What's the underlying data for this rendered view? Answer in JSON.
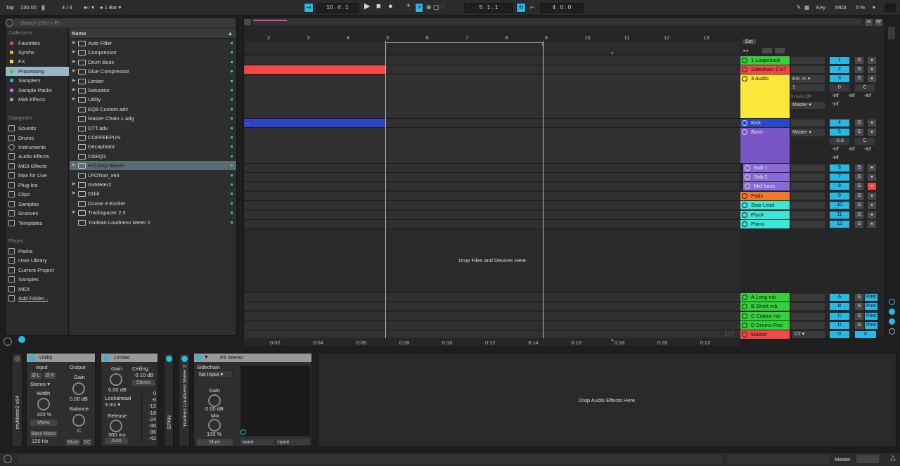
{
  "transport": {
    "tap": "Tap",
    "tempo": "130.00",
    "signature": "4 / 4",
    "quantize": "1 Bar",
    "position": "10 . 4 . 1",
    "loop_start": "5 . 1 . 1",
    "loop_length": "4 . 0 . 0",
    "key_label": "Key",
    "midi_label": "MIDI",
    "cpu": "5 %"
  },
  "browser": {
    "search_placeholder": "Search (Ctrl + F)",
    "collections_label": "Collections",
    "collections": [
      {
        "label": "Favorites",
        "color": "#e8442f"
      },
      {
        "label": "Synths",
        "color": "#f0a33c"
      },
      {
        "label": "FX",
        "color": "#f2e33c"
      },
      {
        "label": "Processing",
        "color": "#39c74a"
      },
      {
        "label": "Samplers",
        "color": "#3aa6e8"
      },
      {
        "label": "Sample Packs",
        "color": "#b36fe0"
      },
      {
        "label": "Midi Effects",
        "color": "#9a9a9a"
      }
    ],
    "categories_label": "Categories",
    "categories": [
      "Sounds",
      "Drums",
      "Instruments",
      "Audio Effects",
      "MIDI Effects",
      "Max for Live",
      "Plug-Ins",
      "Clips",
      "Samples",
      "Grooves",
      "Templates"
    ],
    "places_label": "Places",
    "places": [
      "Packs",
      "User Library",
      "Current Project",
      "Samples",
      "MIDI",
      "Add Folder..."
    ],
    "name_header": "Name",
    "items": [
      {
        "label": "Auto Filter",
        "folder": true
      },
      {
        "label": "Compressor",
        "folder": true
      },
      {
        "label": "Drum Buss",
        "folder": true
      },
      {
        "label": "Glue Compressor",
        "folder": true
      },
      {
        "label": "Limiter",
        "folder": true
      },
      {
        "label": "Saturator",
        "folder": true
      },
      {
        "label": "Utility",
        "folder": true
      },
      {
        "label": "EQ8 Custom.adv",
        "folder": false
      },
      {
        "label": "Master Chain 1.adg",
        "folder": false
      },
      {
        "label": "OTT.adv",
        "folder": false
      },
      {
        "label": "COFFEEPUN",
        "folder": false
      },
      {
        "label": "Decapitator",
        "folder": false
      },
      {
        "label": "DSEQ3",
        "folder": false
      },
      {
        "label": "H-Comp Stereo",
        "folder": true
      },
      {
        "label": "LFOTool_x64",
        "folder": false
      },
      {
        "label": "mvMeter2",
        "folder": true
      },
      {
        "label": "Orbit",
        "folder": true
      },
      {
        "label": "Ozone 9 Exciter",
        "folder": false
      },
      {
        "label": "Trackspacer 2.5",
        "folder": true
      },
      {
        "label": "Youlean Loudness Meter 2",
        "folder": false
      }
    ]
  },
  "arrangement": {
    "bars": [
      "2",
      "3",
      "4",
      "5",
      "6",
      "7",
      "8",
      "9",
      "10",
      "11",
      "12",
      "13"
    ],
    "times": [
      "0:02",
      "0:04",
      "0:06",
      "0:08",
      "0:10",
      "0:12",
      "0:14",
      "0:16",
      "0:18",
      "0:20",
      "0:22"
    ],
    "drop_files": "Drop Files and Devices Here",
    "set_label": "Set",
    "page_indicator": "1/4",
    "clip_label": "..."
  },
  "tracks": [
    {
      "name": "1 Loopcloud",
      "color": "#35d13a",
      "num": "1"
    },
    {
      "name": "Sidechain CNT",
      "color": "#f44848",
      "num": "2"
    },
    {
      "name": "3 Audio",
      "color": "#f9e83a",
      "num": "3",
      "input": "Ext. In",
      "channel": "1",
      "out": "Master",
      "vol": "0",
      "pan": "C",
      "inf1": "-inf",
      "inf2": "-inf",
      "inf3": "-inf",
      "inf4": "-inf"
    },
    {
      "name": "Kick",
      "color": "#2b46c8",
      "num": "4"
    },
    {
      "name": "Bass",
      "color": "#7a55c8",
      "num": "5",
      "out": "Master",
      "vol": "-5.8",
      "pan": "C",
      "inf1": "-inf",
      "inf2": "-inf",
      "inf3": "-inf",
      "inf4": "-inf"
    },
    {
      "name": "Sub 1",
      "color": "#8a6ad8",
      "num": "6"
    },
    {
      "name": "Sub 2",
      "color": "#8a6ad8",
      "num": "7"
    },
    {
      "name": "Mid bass",
      "color": "#8a6ad8",
      "num": "8"
    },
    {
      "name": "Pads",
      "color": "#f07a28",
      "num": "9"
    },
    {
      "name": "Saw Lead",
      "color": "#3ae8d8",
      "num": "10"
    },
    {
      "name": "Pluck",
      "color": "#3ae8d8",
      "num": "11"
    },
    {
      "name": "Piano",
      "color": "#3ae8d8",
      "num": "12"
    }
  ],
  "returns": [
    {
      "name": "A Long rvb",
      "num": "A"
    },
    {
      "name": "B Short rvb",
      "num": "B"
    },
    {
      "name": "C Colour rvb",
      "num": "C"
    },
    {
      "name": "D Drums Roo",
      "num": "D"
    }
  ],
  "master": {
    "name": "Master",
    "route": "1/2",
    "vol": "0",
    "pan": "0"
  },
  "mixer_labels": {
    "solo": "S",
    "post": "Post",
    "in": "In",
    "auto": "Auto",
    "off": "Off"
  },
  "devices": {
    "mvmeter": "mvMeter2 x64",
    "utility": {
      "title": "Utility",
      "input": "Input",
      "output": "Output",
      "mode": "Stereo",
      "width_label": "Width",
      "width": "100 %",
      "gain_label": "Gain",
      "gain": "0.00 dB",
      "balance_label": "Balance",
      "balance": "C",
      "mono": "Mono",
      "bass_mono": "Bass Mono",
      "freq": "120 Hz",
      "mute": "Mute",
      "dc": "DC",
      "phase_l": "Ø L",
      "phase_r": "Ø R"
    },
    "limiter": {
      "title": "Limiter",
      "gain_label": "Gain",
      "gain": "0.00 dB",
      "ceiling_label": "Ceiling",
      "ceiling": "-0.10 dB",
      "stereo": "Stereo",
      "lookahead_label": "Lookahead",
      "lookahead": "3 ms",
      "release_label": "Release",
      "release": "300 ms",
      "auto": "Auto",
      "scale": [
        "0",
        "-6",
        "-12",
        "-18",
        "-24",
        "-30",
        "-36",
        "-42"
      ]
    },
    "span": "SPAN",
    "youlean": "Youlean Loudness Meter 2",
    "f6": {
      "title": "F6 Stereo",
      "sidechain_label": "Sidechain",
      "sidechain": "No Input",
      "gain_label": "Gain",
      "gain": "0.00 dB",
      "mix_label": "Mix",
      "mix": "100 %",
      "mute": "Mute",
      "none1": "none",
      "none2": "none"
    },
    "drop_audio": "Drop Audio Effects Here"
  },
  "status": {
    "master_label": "Master"
  }
}
